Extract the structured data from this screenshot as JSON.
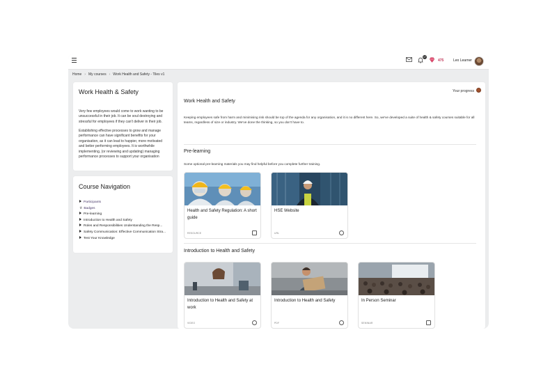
{
  "topbar": {
    "menu_icon": "hamburger-icon",
    "mail_icon": "envelope-icon",
    "notifications_icon": "bell-icon",
    "notifications_badge": "17",
    "points_icon": "gem-icon",
    "points": "475",
    "user_name": "Leo Learner"
  },
  "breadcrumb": [
    "Home",
    "My courses",
    "Work Health and Safety - Tiles v1"
  ],
  "left_card": {
    "title": "Work Health & Safety",
    "para1": "Very few employees would come to work wanting to be unsuccessful in their job. It can be soul destroying and stressful for employees if they can't deliver in their job.",
    "para2": "Establishing effective processes to grow and manage performance can have significant benefits for your organisation, as it can lead to happier, more motivated and better performing employees. It is worthwhile implementing, (or reviewing and updating) managing performance processes to support your organisation"
  },
  "course_nav": {
    "title": "Course Navigation",
    "items": [
      "Participants",
      "Badges",
      "Pre-learning",
      "Introduction to Health and Safety",
      "Roles and Responsibilities Understanding the Resp...",
      "Safety Communication: Effective Communication Stra...",
      "Test Your Knowledge"
    ]
  },
  "main": {
    "progress_label": "Your progress",
    "title": "Work Health and Safety",
    "intro": "Keeping employees safe from harm and minimising risk should be top of the agenda for any organisation, and it is no different here. So, we've developed a suite of health & safety courses suitable for all teams, regardless of size or industry. We've done the thinking, so you don't have to.",
    "sections": [
      {
        "title": "Pre-learning",
        "subtitle": "Some optional pre-learning materials you may find helpful before you complete further training.",
        "tiles": [
          {
            "title": "Health and Safety Regulation: A short guide",
            "type": "RESOURCE"
          },
          {
            "title": "HSE Website",
            "type": "URL"
          }
        ]
      },
      {
        "title": "Introduction to Health and Safety",
        "tiles": [
          {
            "title": "Introduction to Health and Safety at work",
            "type": "VIDEO"
          },
          {
            "title": "Introduction to Health and Safety",
            "type": "PDF"
          },
          {
            "title": "In Person Seminar",
            "type": "SEMINAR"
          }
        ]
      }
    ]
  },
  "colors": {
    "accent": "#c2385a",
    "background": "#ecedee",
    "card": "#ffffff"
  }
}
